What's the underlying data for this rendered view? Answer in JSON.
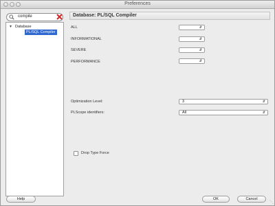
{
  "window": {
    "title": "Preferences"
  },
  "search": {
    "value": "compile"
  },
  "tree": {
    "root": {
      "label": "Database",
      "expanded": true
    },
    "selected": {
      "label": "PL/SQL Compiler"
    }
  },
  "panel": {
    "header": "Database: PL/SQL Compiler",
    "warnings": [
      {
        "label": "ALL",
        "value": ""
      },
      {
        "label": "INFORMATIONAL",
        "value": ""
      },
      {
        "label": "SEVERE",
        "value": ""
      },
      {
        "label": "PERFORMANCE",
        "value": ""
      }
    ],
    "optimization": {
      "label": "Optimization Level:",
      "value": "3"
    },
    "plscope": {
      "label": "PLScope identifiers:",
      "value": "All"
    },
    "drop_type_force": {
      "label": "Drop Type Force",
      "checked": false
    }
  },
  "buttons": {
    "help": "Help",
    "ok": "OK",
    "cancel": "Cancel"
  }
}
